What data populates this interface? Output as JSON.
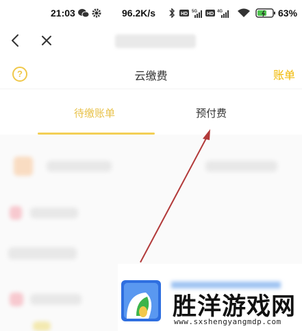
{
  "status_bar": {
    "time": "21:03",
    "net_speed": "96.2K/s",
    "battery": "63%",
    "icons": [
      "wechat-icon",
      "gear-icon",
      "bluetooth-icon",
      "hd-icon",
      "signal-5g-icon",
      "hd-icon",
      "signal-4g-icon",
      "wifi-icon",
      "battery-icon"
    ]
  },
  "nav": {
    "back_icon": "chevron-left-icon",
    "close_icon": "close-icon"
  },
  "header": {
    "help_symbol": "?",
    "title": "云缴费",
    "bill_link": "账单"
  },
  "tabs": [
    {
      "label": "待缴账单",
      "active": true
    },
    {
      "label": "预付费",
      "active": false
    }
  ],
  "watermark": {
    "brand": "胜洋游戏网",
    "url": "www.sxshengyangmdp.com"
  },
  "colors": {
    "accent": "#f0b800",
    "tab_active": "#e8c24a",
    "arrow": "#b23a3a"
  }
}
